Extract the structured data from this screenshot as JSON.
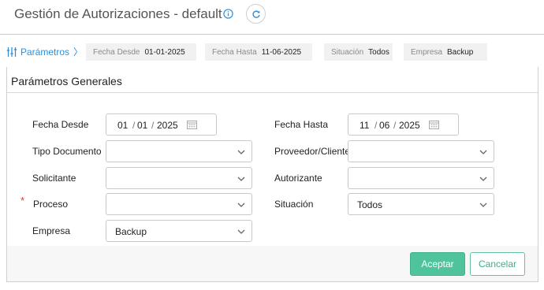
{
  "header": {
    "title": "Gestión de Autorizaciones - default",
    "info_icon": "info-circle-icon",
    "refresh_icon": "refresh-icon"
  },
  "filterbar": {
    "params_label": "Parámetros",
    "params_chevron": "〉",
    "chips": [
      {
        "key": "Fecha Desde",
        "value": "01-01-2025"
      },
      {
        "key": "Fecha Hasta",
        "value": "11-06-2025"
      },
      {
        "key": "Situación",
        "value": "Todos"
      },
      {
        "key": "Empresa",
        "value": "Backup"
      }
    ]
  },
  "panel": {
    "title": "Parámetros Generales",
    "fecha_desde": {
      "label": "Fecha Desde",
      "day": "01",
      "month": "01",
      "year": "2025"
    },
    "fecha_hasta": {
      "label": "Fecha Hasta",
      "day": "11",
      "month": "06",
      "year": "2025"
    },
    "tipo_documento": {
      "label": "Tipo Documento",
      "value": ""
    },
    "proveedor_cliente": {
      "label": "Proveedor/Cliente",
      "value": ""
    },
    "solicitante": {
      "label": "Solicitante",
      "value": ""
    },
    "autorizante": {
      "label": "Autorizante",
      "value": ""
    },
    "proceso": {
      "label": "Proceso",
      "required_mark": "*",
      "value": ""
    },
    "situacion": {
      "label": "Situación",
      "value": "Todos"
    },
    "empresa": {
      "label": "Empresa",
      "value": "Backup"
    },
    "date_separator": "/"
  },
  "actions": {
    "accept": "Aceptar",
    "cancel": "Cancelar"
  },
  "colors": {
    "accent_blue": "#2f8fd6",
    "accept_green": "#4fc49c",
    "required_red": "#e2383f"
  }
}
